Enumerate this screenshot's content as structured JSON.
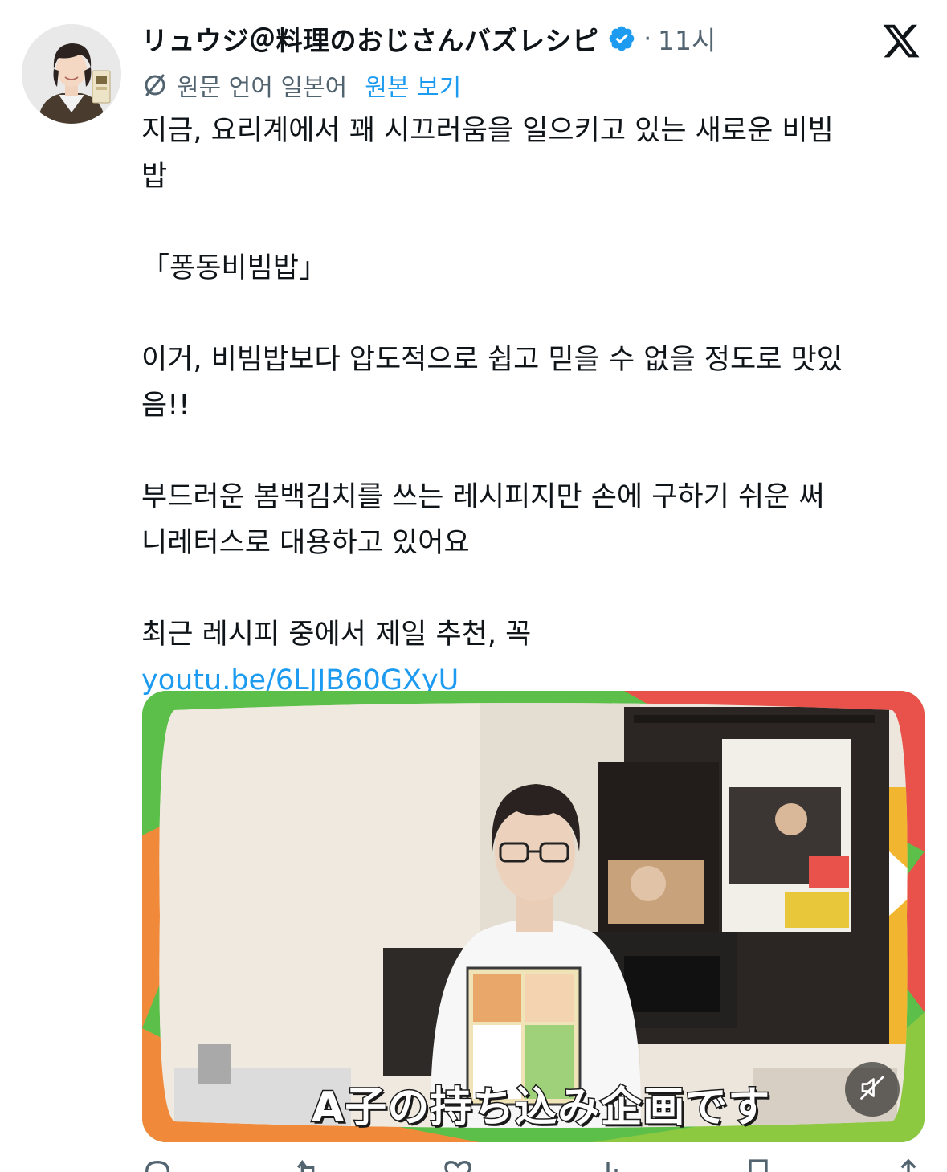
{
  "tweet": {
    "display_name": "リュウジ＠料理のおじさんバズレシピ",
    "separator": "·",
    "time": "11시",
    "translation": {
      "label": "원문 언어 일본어",
      "view_original": "원본 보기"
    },
    "body": {
      "p1": "지금, 요리계에서 꽤 시끄러움을 일으키고 있는 새로운 비빔\n밥",
      "p2": "「퐁동비빔밥」",
      "p3": "이거, 비빔밥보다 압도적으로 쉽고 믿을 수 없을 정도로 맛있\n음!!",
      "p4": "부드러운 봄백김치를 쓰는 레시피지만 손에 구하기 쉬운 써\n니레터스로 대용하고 있어요",
      "p5": "최근 레시피 중에서 제일 추천, 꼭",
      "link": "youtu.be/6LJJB60GXyU"
    },
    "media": {
      "caption": "A子の持ち込み企画です"
    }
  },
  "icons": {
    "avatar": "avatar",
    "verified": "verified-badge-icon",
    "x_logo": "x-logo-icon",
    "translate": "translate-icon",
    "mute": "speaker-muted-icon",
    "reply": "reply-icon",
    "retweet": "retweet-icon",
    "like": "heart-icon",
    "views": "views-icon",
    "bookmark": "bookmark-icon",
    "share": "share-icon"
  },
  "colors": {
    "text": "#0f1419",
    "secondary": "#536471",
    "accent": "#1d9bf0",
    "media_frame_green": "#5cbf4a",
    "media_frame_red": "#e8524a",
    "media_frame_orange": "#f08a3a"
  }
}
